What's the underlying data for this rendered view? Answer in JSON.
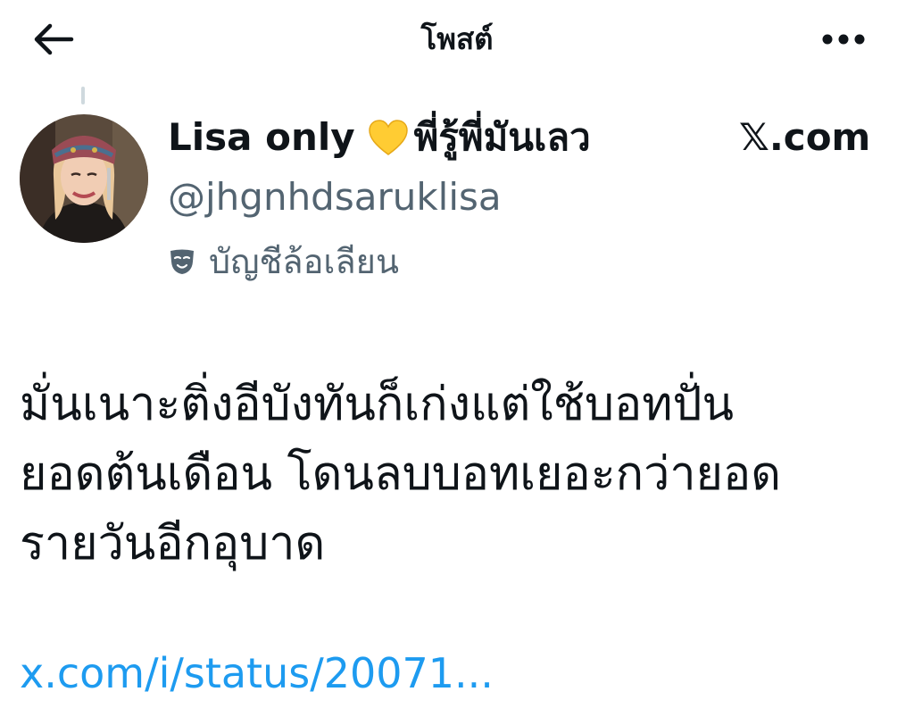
{
  "header": {
    "title": "โพสต์",
    "back_icon": "arrow-left-icon",
    "more_icon": "more-horizontal-icon"
  },
  "author": {
    "display_name": "Lisa only",
    "emoji": "yellow-heart",
    "name_suffix": "พี่รู้พี่มันเลว",
    "handle": "@jhgnhdsaruklisa",
    "label": "บัญชีล้อเลียน",
    "label_icon": "parody-mask-icon"
  },
  "source": {
    "label": "𝕏.com"
  },
  "tweet": {
    "lines": [
      "มั่นเนาะติ่งอีบังทันก็เก่งแต่ใช้บอทปั่น",
      "ยอดต้นเดือน โดนลบบอทเยอะกว่ายอด",
      "รายวันอีกอุบาด"
    ],
    "link": "x.com/i/status/20071..."
  },
  "colors": {
    "text": "#0f1419",
    "secondary": "#536471",
    "link": "#1d9bf0",
    "background": "#ffffff"
  }
}
